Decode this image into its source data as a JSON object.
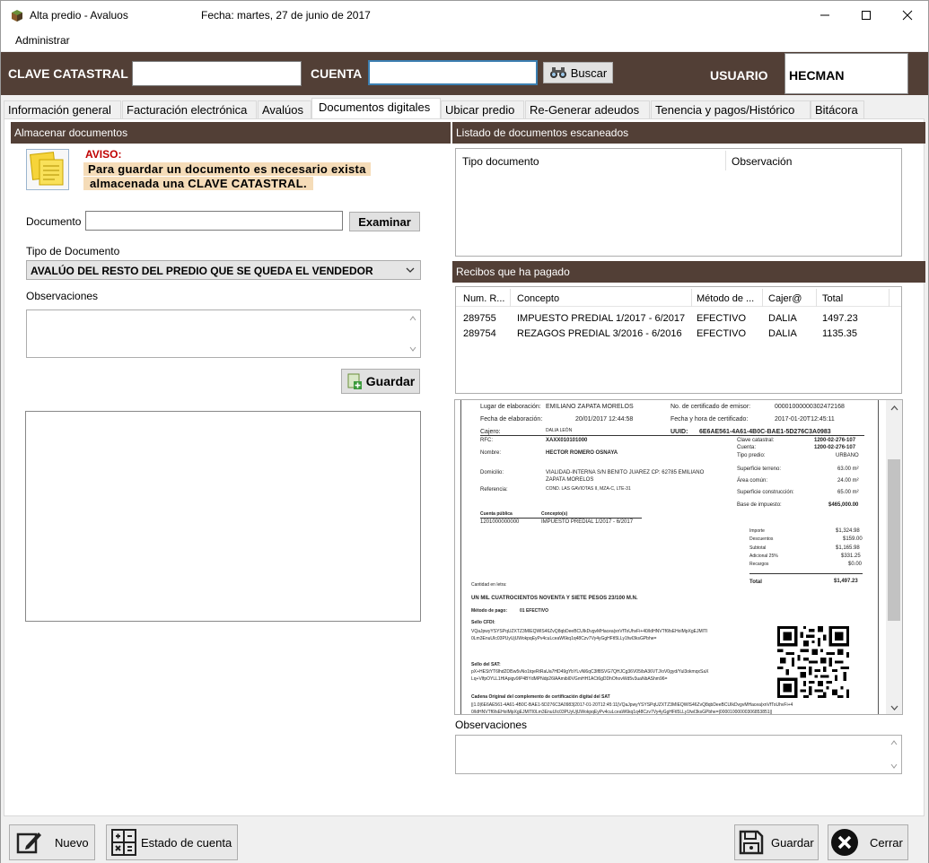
{
  "window": {
    "title": "Alta predio - Avaluos",
    "date": "Fecha: martes, 27 de junio de 2017"
  },
  "menu": {
    "item": "Administrar"
  },
  "top": {
    "clave_label": "CLAVE CATASTRAL",
    "clave_value": "",
    "cuenta_label": "CUENTA",
    "cuenta_value": "",
    "buscar": "Buscar",
    "usuario_label": "USUARIO",
    "usuario_value": "HECMAN"
  },
  "tabs": [
    "Información general",
    "Facturación electrónica",
    "Avalúos",
    "Documentos digitales",
    "Ubicar predio",
    "Re-Generar adeudos",
    "Tenencia y pagos/Histórico",
    "Bitácora"
  ],
  "left": {
    "header": "Almacenar documentos",
    "aviso_title": "AVISO:",
    "aviso_line1": "Para guardar un documento es necesario exista",
    "aviso_line2": "almacenada una CLAVE CATASTRAL.",
    "documento_label": "Documento",
    "documento_value": "",
    "examinar": "Examinar",
    "tipo_label": "Tipo de Documento",
    "tipo_value": "AVALÚO DEL RESTO DEL PREDIO QUE SE QUEDA EL VENDEDOR",
    "obs_label": "Observaciones",
    "obs_value": "",
    "guardar": "Guardar"
  },
  "right": {
    "listado_header": "Listado de documentos escaneados",
    "listado_cols": [
      "Tipo documento",
      "Observación"
    ],
    "recibos_header": "Recibos que ha pagado",
    "recibos_cols": [
      "Num. R...",
      "Concepto",
      "Método de ...",
      "Cajer@",
      "Total"
    ],
    "recibos_rows": [
      [
        "289755",
        "IMPUESTO PREDIAL 1/2017 - 6/2017",
        "EFECTIVO",
        "DALIA",
        "1497.23"
      ],
      [
        "289754",
        "REZAGOS PREDIAL 3/2016 - 6/2016",
        "EFECTIVO",
        "DALIA",
        "1135.35"
      ]
    ],
    "obs_label": "Observaciones",
    "obs_value": ""
  },
  "receipt": {
    "lugar_label": "Lugar de elaboración:",
    "lugar": "EMILIANO ZAPATA MORELOS",
    "cert_label": "No. de certificado de emisor:",
    "cert": "00001000000302472168",
    "fecha_label": "Fecha de elaboración:",
    "fecha": "20/01/2017 12:44:58",
    "fecha_cert_label": "Fecha y hora de certificado:",
    "fecha_cert": "2017-01-20T12:45:11",
    "cajero_label": "Cajero:",
    "cajero": "DALIA LEÓN",
    "uuid_label": "UUID:",
    "uuid": "6E6AE561-4A61-4B0C-BAE1-5D276C3A0983",
    "rfc_label": "RFC:",
    "rfc": "XAXX010101000",
    "nombre_label": "Nombre:",
    "nombre": "HECTOR ROMERO OSNAYA",
    "domicilio_label": "Domicilio:",
    "domicilio1": "VIALIDAD-INTERNA S/N BENITO JUAREZ CP: 62785 EMILIANO",
    "domicilio2": "ZAPATA MORELOS",
    "referencia_label": "Referencia:",
    "referencia": "COND. LAS GAVIOTAS II, MZA-C, LTE-31",
    "clave_cat_label": "Clave catastral:",
    "clave_cat": "1200-02-276-107",
    "cuenta_label": "Cuenta:",
    "cuenta": "1200-02-276-107",
    "tipo_label": "Tipo predio:",
    "tipo": "URBANO",
    "sup_terreno_label": "Superficie terreno:",
    "sup_terreno": "63.00 m²",
    "area_comun_label": "Área común:",
    "area_comun": "24.00 m²",
    "sup_const_label": "Superficie construcción:",
    "sup_const": "65.00 m²",
    "base_label": "Base de impuesto:",
    "base": "$465,000.00",
    "cuenta_pub_label": "Cuenta pública",
    "concepto_label": "Concepto(s)",
    "cuenta_pub": "1201000000000",
    "concepto": "IMPUESTO PREDIAL 1/2017 - 6/2017",
    "importe_label": "Importe",
    "importe": "$1,324.98",
    "descuentos_label": "Descuentos",
    "descuentos": "$159.00",
    "subtotal_label": "Subtotal",
    "subtotal": "$1,165.98",
    "adicional_label": "Adicional 25%",
    "adicional": "$331.25",
    "recargos_label": "Recargos",
    "recargos": "$0.00",
    "total_label": "Total",
    "total": "$1,497.23",
    "cantidad_label": "Cantidad en letra:",
    "cantidad": "UN MIL CUATROCIENTOS NOVENTA Y SIETE PESOS 23/100 M.N.",
    "metodo_label": "Método de pago:",
    "metodo": "01 EFECTIVO",
    "sello_cfdi_label": "Sello CFDI:",
    "sello_cfdi1": "VQaJpwyYSYSPqUZXTZ3MIEQWlS46ZvQ8qbDeeBCUIkDvgvMHacea|xnVfToUhvFi+40/ldHNVTf6fsEHolMpXgEJMlTI",
    "sello_cfdi2": "0Lm3EnuUIc03PUyUjUWokpqEyPv4cuLceaW6kq1q48Czv7Vy4yGgHFtl5LLy1fwI3ksGPbhe=",
    "sello_sat_label": "Sello del SAT:",
    "sello_sat1": "pX+HEStYT6lhd2Dl5w5vNo1tqeRtRaUa7HD49gYbYLvNl6qC3lf8SVG7QHJCg36V05/bA36VTJ/oV0gyd/Yul3okmqxSaX",
    "sello_sat2": "Lq+VlfpOYLL1HlApigv9IP4BYdMPNdp26lAAmibl0VGmHH1ACt6gDDhOhovWd5v3uaNbAShm96=",
    "cadena_label": "Cadena Original del complemento de certificación digital del SAT",
    "cadena1": "||1.0|6E6AE561-4A61-4B0C-BAE1-5D276C3A0983|2017-01-20T12:45:11|VQaJpwyYSYSPqUZXTZ3MIEQWlS46ZvQ8qbDeeBCUIkDvgvMHacea|xnVfToUhvFi+4",
    "cadena2": "0/ldHNVTf6fsEHolMpXgEJMlTI0Lm3EnuUIc03PUyUjUWokpqEyPv4cuLceaW6kq1q48Czv7Vy4yGgHFtl5LLy1fwI3ksGPbhe=|00001000000306853851||"
  },
  "bottom": {
    "nuevo": "Nuevo",
    "estado": "Estado de cuenta",
    "guardar": "Guardar",
    "cerrar": "Cerrar"
  }
}
